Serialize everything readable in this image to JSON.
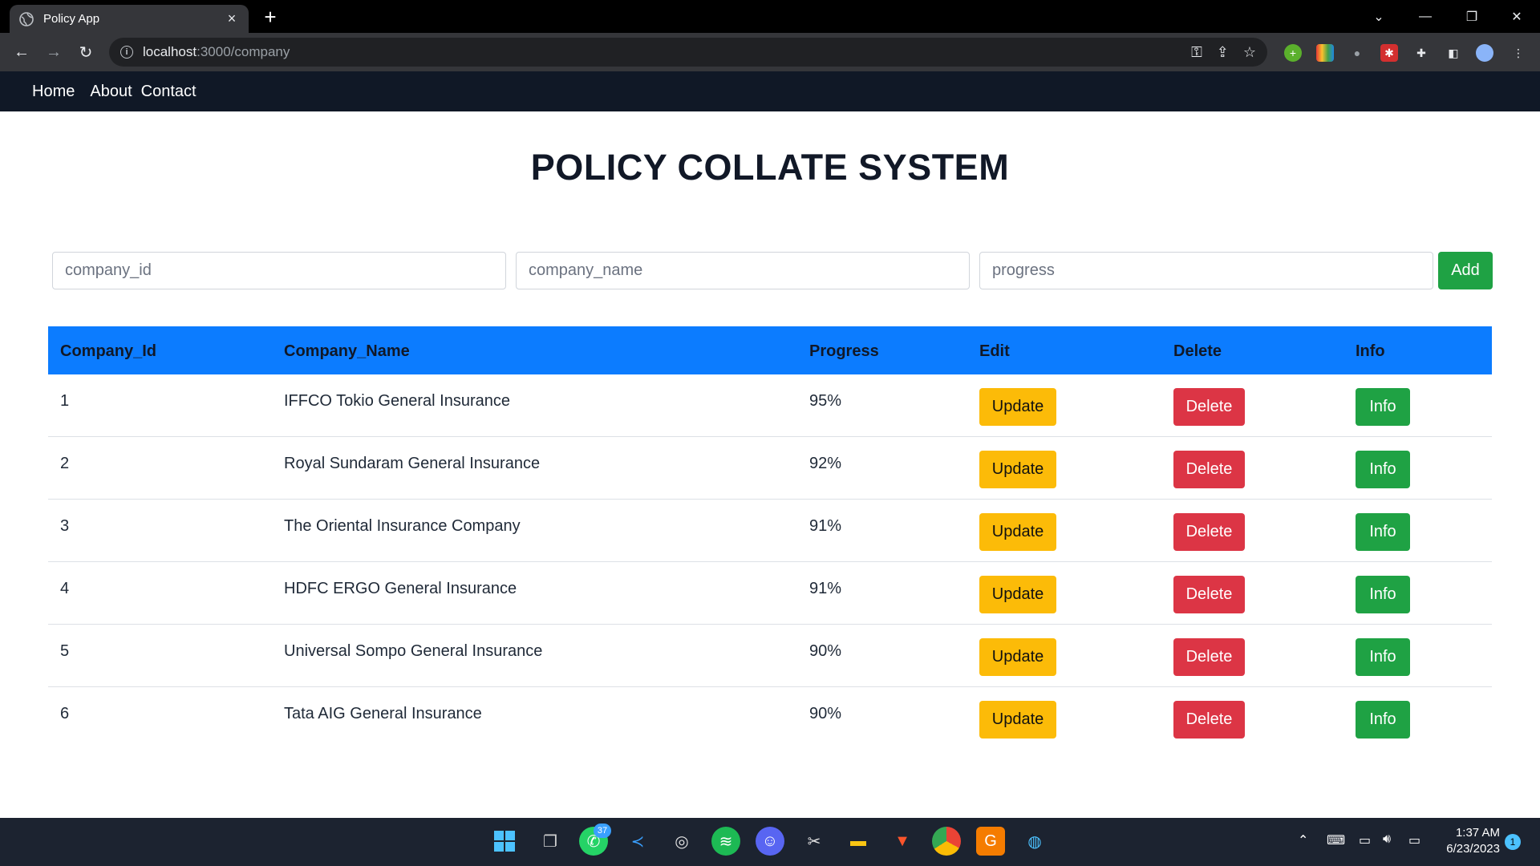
{
  "browser": {
    "tab_title": "Policy App",
    "url_host": "localhost",
    "url_path": ":3000/company"
  },
  "nav": {
    "home": "Home",
    "about": "About",
    "contact": "Contact"
  },
  "page": {
    "title": "POLICY COLLATE SYSTEM"
  },
  "form": {
    "company_id_placeholder": "company_id",
    "company_name_placeholder": "company_name",
    "progress_placeholder": "progress",
    "add_label": "Add"
  },
  "table": {
    "headers": [
      "Company_Id",
      "Company_Name",
      "Progress",
      "Edit",
      "Delete",
      "Info"
    ],
    "rows": [
      {
        "id": "1",
        "name": "IFFCO Tokio General Insurance",
        "progress": "95%"
      },
      {
        "id": "2",
        "name": "Royal Sundaram General Insurance",
        "progress": "92%"
      },
      {
        "id": "3",
        "name": "The Oriental Insurance Company",
        "progress": "91%"
      },
      {
        "id": "4",
        "name": "HDFC ERGO General Insurance",
        "progress": "91%"
      },
      {
        "id": "5",
        "name": "Universal Sompo General Insurance",
        "progress": "90%"
      },
      {
        "id": "6",
        "name": "Tata AIG General Insurance",
        "progress": "90%"
      }
    ],
    "update_label": "Update",
    "delete_label": "Delete",
    "info_label": "Info"
  },
  "taskbar": {
    "whatsapp_badge": "37",
    "time": "1:37 AM",
    "date": "6/23/2023",
    "notification_count": "1"
  },
  "colors": {
    "header_bg": "#0c7cff",
    "navbar_bg": "#101826",
    "update": "#fcbb08",
    "delete": "#dc3545",
    "success": "#1fa244"
  }
}
